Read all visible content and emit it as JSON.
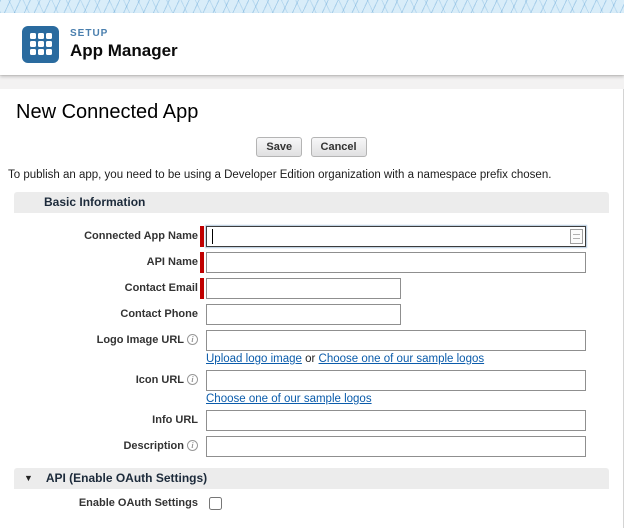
{
  "colors": {
    "brand_blue": "#2a6b9f",
    "required_red": "#c00000",
    "link_blue": "#0b5cab",
    "section_bg": "#ececec"
  },
  "header": {
    "setup_label": "SETUP",
    "title": "App Manager"
  },
  "page": {
    "title": "New Connected App",
    "save_label": "Save",
    "cancel_label": "Cancel",
    "notice": "To publish an app, you need to be using a Developer Edition organization with a namespace prefix chosen."
  },
  "sections": {
    "basic": "Basic Information",
    "oauth": "API (Enable OAuth Settings)"
  },
  "icons": {
    "collapse_triangle": "▼",
    "info_glyph": "i"
  },
  "fields": {
    "connected_app_name": {
      "label": "Connected App Name",
      "required": true,
      "value": ""
    },
    "api_name": {
      "label": "API Name",
      "required": true,
      "value": ""
    },
    "contact_email": {
      "label": "Contact Email",
      "required": true,
      "value": ""
    },
    "contact_phone": {
      "label": "Contact Phone",
      "required": false,
      "value": ""
    },
    "logo_image_url": {
      "label": "Logo Image URL",
      "required": false,
      "value": ""
    },
    "icon_url": {
      "label": "Icon URL",
      "required": false,
      "value": ""
    },
    "info_url": {
      "label": "Info URL",
      "required": false,
      "value": ""
    },
    "description": {
      "label": "Description",
      "required": false,
      "value": ""
    },
    "enable_oauth": {
      "label": "Enable OAuth Settings",
      "checked": false
    }
  },
  "links": {
    "upload_logo": "Upload logo image",
    "or_separator": "or",
    "sample_logos_1": "Choose one of our sample logos",
    "sample_logos_2": "Choose one of our sample logos"
  }
}
